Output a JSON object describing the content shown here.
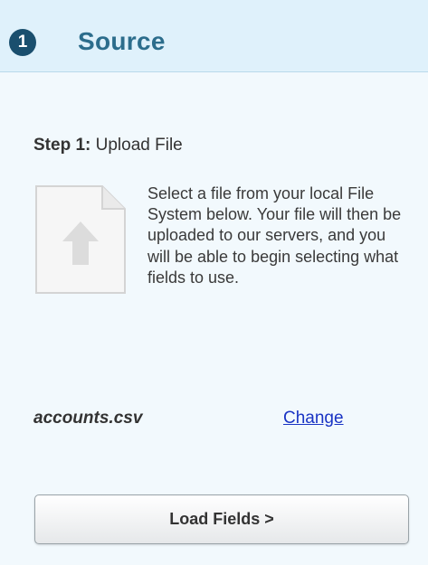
{
  "header": {
    "step_number": "1",
    "title": "Source"
  },
  "step": {
    "label": "Step 1:",
    "name": "Upload File"
  },
  "upload": {
    "icon": "file-upload-icon",
    "description": "Select a file from your local File System below. Your file will then be uploaded to our servers, and you will be able to begin selecting what fields to use.",
    "filename": "accounts.csv",
    "change_label": "Change"
  },
  "actions": {
    "load_fields_label": "Load Fields >"
  },
  "colors": {
    "header_bg": "#dff1fb",
    "title": "#2c6d8c",
    "step_badge": "#1a4f6e",
    "link": "#1a34c4"
  }
}
